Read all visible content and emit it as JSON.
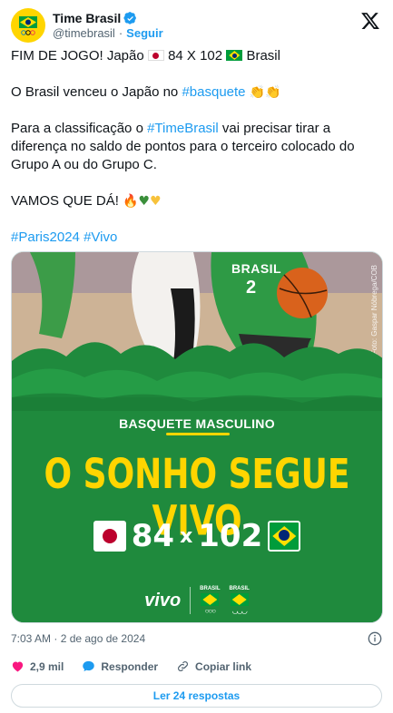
{
  "author": {
    "name": "Time Brasil",
    "handle": "@timebrasil",
    "follow_label": "Seguir",
    "separator": "·"
  },
  "post": {
    "line1_prefix": "FIM DE JOGO! Japão",
    "line1_score": "84 X 102",
    "line1_suffix": "Brasil",
    "line2_text": "O Brasil venceu o Japão no",
    "line2_hashtag": "#basquete",
    "line3_a": "Para a classificação o",
    "line3_hashtag": "#TimeBrasil",
    "line3_b": "vai precisar tirar a diferença no saldo de pontos para o terceiro colocado do Grupo A ou do Grupo C.",
    "line4_text": "VAMOS QUE DÁ!",
    "hashtags": [
      "#Paris2024",
      "#Vivo"
    ]
  },
  "media": {
    "photo_credit": "Foto: Gaspar Nóbrega/COB",
    "jersey_text": "BRASIL",
    "jersey_number": "2",
    "category": "BASQUETE MASCULINO",
    "headline": "O SONHO SEGUE VIVO",
    "score_japan": "84",
    "score_x": "x",
    "score_brazil": "102",
    "sponsor": "vivo",
    "badge1": "BRASIL",
    "badge2": "BRASIL"
  },
  "meta": {
    "timestamp": "7:03 AM · 2 de ago de 2024"
  },
  "actions": {
    "likes": "2,9 mil",
    "reply_label": "Responder",
    "copy_label": "Copiar link"
  },
  "replies_button": "Ler 24 respostas",
  "colors": {
    "accent": "#1d9bf0",
    "green": "#1f8a3d",
    "yellow": "#ffd500",
    "like": "#f91880"
  }
}
